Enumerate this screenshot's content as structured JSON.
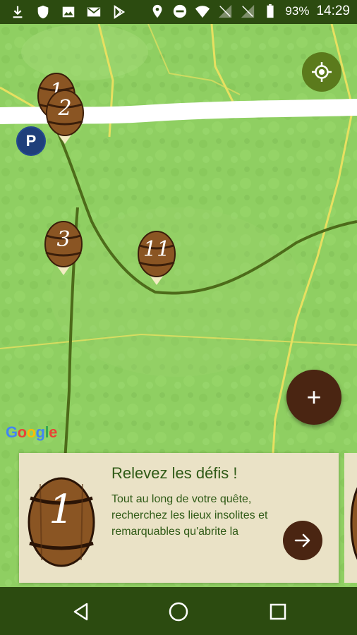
{
  "status_bar": {
    "left_icons": [
      "download-icon",
      "shield-icon",
      "image-icon",
      "mail-icon",
      "play-store-icon"
    ],
    "right_icons": [
      "location-icon",
      "do-not-disturb-icon",
      "wifi-icon",
      "signal-icon",
      "signal-icon",
      "battery-icon"
    ],
    "battery": "93%",
    "time": "14:29"
  },
  "map": {
    "markers": [
      {
        "number": "1"
      },
      {
        "number": "2"
      },
      {
        "number": "3"
      },
      {
        "number": "11"
      }
    ],
    "parking_label": "P",
    "google_logo": "Google",
    "add_label": "+"
  },
  "card": {
    "title": "Relevez les défis !",
    "text": "Tout au long de votre quête, recherchez les lieux insolites et remarquables qu'abrite la",
    "barrel_number": "1"
  },
  "nav_bar": {
    "buttons": [
      "back",
      "home",
      "recents"
    ]
  },
  "colors": {
    "status_bar": "#2c4b10",
    "map_green": "#8fcf62",
    "brown": "#4a2512",
    "card_bg": "#eae2c6",
    "title_green": "#2f5a16"
  }
}
